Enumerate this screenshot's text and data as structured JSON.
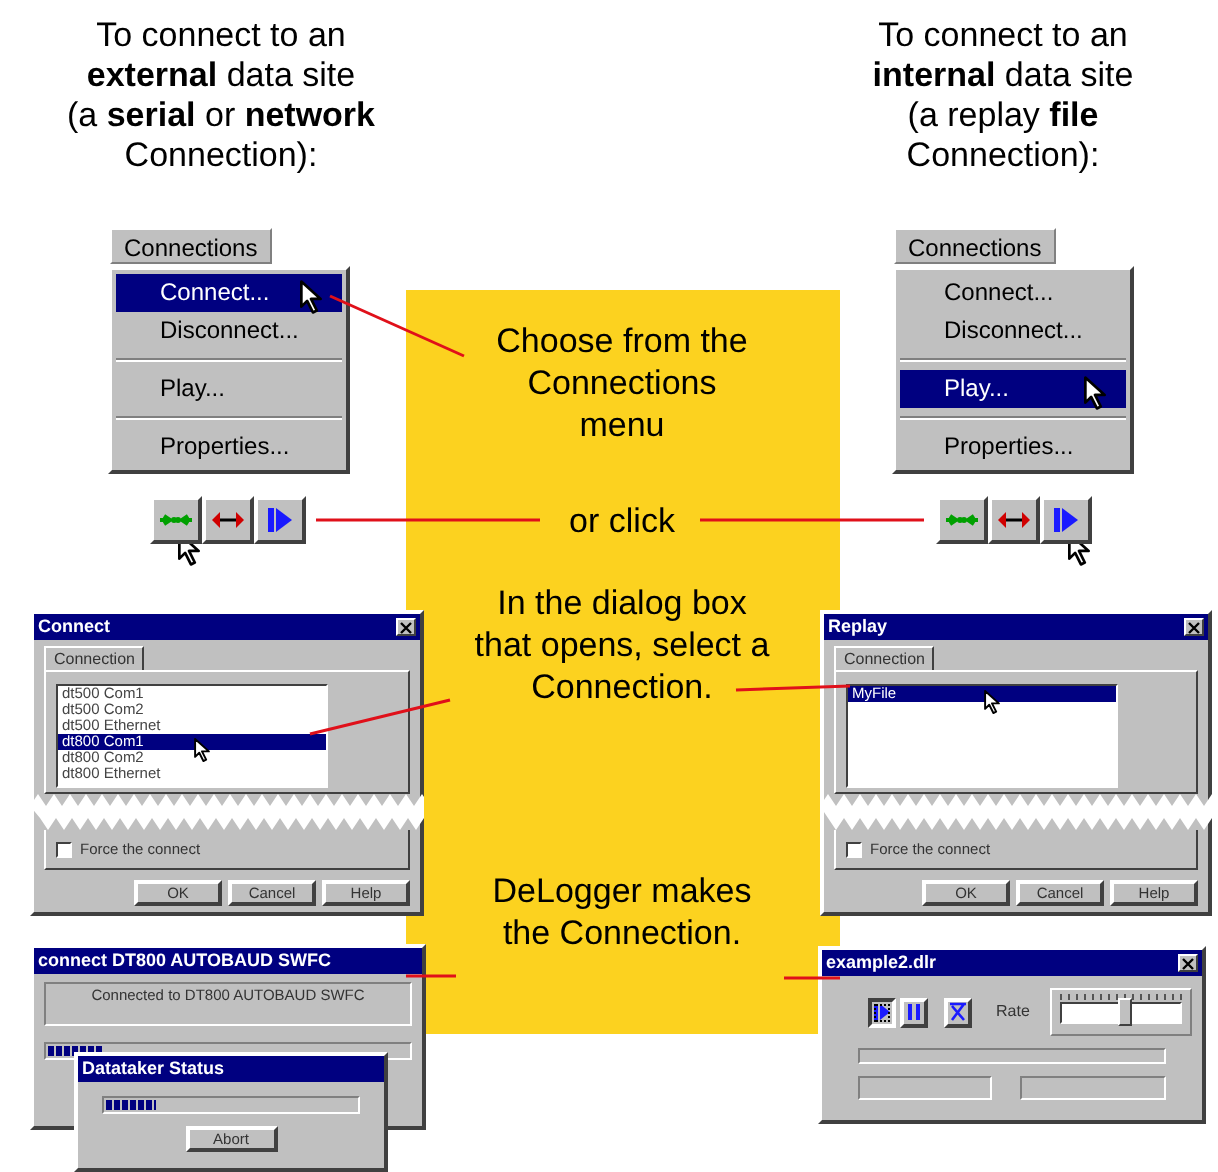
{
  "left_heading": {
    "lines": [
      "To connect to an",
      "**external** data site",
      "(a **serial** or **network**",
      "Connection):"
    ]
  },
  "right_heading": {
    "lines": [
      "To connect to an",
      "**internal** data site",
      "(a replay **file**",
      "Connection):"
    ]
  },
  "steps": [
    {
      "lines": [
        "Choose from the",
        "Connections",
        "menu"
      ]
    },
    {
      "lines": [
        "or click"
      ]
    },
    {
      "lines": [
        "In the dialog box",
        "that opens, select a",
        "Connection."
      ]
    },
    {
      "lines": [
        "DeLogger makes",
        "the Connection."
      ]
    }
  ],
  "menus": [
    {
      "title": "Connections",
      "items": [
        {
          "kind": "item",
          "label": "Connect...",
          "selected": true
        },
        {
          "kind": "item",
          "label": "Disconnect...",
          "selected": false
        },
        {
          "kind": "separator"
        },
        {
          "kind": "item",
          "label": "Play...",
          "selected": false
        },
        {
          "kind": "separator"
        },
        {
          "kind": "item",
          "label": "Properties...",
          "selected": false
        }
      ]
    },
    {
      "title": "Connections",
      "items": [
        {
          "kind": "item",
          "label": "Connect...",
          "selected": false
        },
        {
          "kind": "item",
          "label": "Disconnect...",
          "selected": false
        },
        {
          "kind": "separator"
        },
        {
          "kind": "item",
          "label": "Play...",
          "selected": true
        },
        {
          "kind": "separator"
        },
        {
          "kind": "item",
          "label": "Properties...",
          "selected": false
        }
      ]
    }
  ],
  "toolbars": [
    {
      "buttons": [
        {
          "kind": "connect",
          "hovered": true
        },
        {
          "kind": "disconnect",
          "hovered": false
        },
        {
          "kind": "play",
          "hovered": false
        }
      ]
    },
    {
      "buttons": [
        {
          "kind": "connect",
          "hovered": false
        },
        {
          "kind": "disconnect",
          "hovered": false
        },
        {
          "kind": "play",
          "hovered": true
        }
      ]
    }
  ],
  "dialogs": [
    {
      "title": "Connect",
      "tab": "Connection",
      "items": [
        {
          "label": "dt500 Com1",
          "selected": false
        },
        {
          "label": "dt500 Com2",
          "selected": false
        },
        {
          "label": "dt500 Ethernet",
          "selected": false
        },
        {
          "label": "dt800 Com1",
          "selected": true
        },
        {
          "label": "dt800 Com2",
          "selected": false
        },
        {
          "label": "dt800 Ethernet",
          "selected": false
        }
      ],
      "checkbox": {
        "label": "Force the connect",
        "checked": false
      },
      "buttons": [
        "OK",
        "Cancel",
        "Help"
      ]
    },
    {
      "title": "Replay",
      "tab": "Connection",
      "items": [
        {
          "label": "MyFile",
          "selected": true
        }
      ],
      "checkbox": {
        "label": "Force the connect",
        "checked": false
      },
      "buttons": [
        "OK",
        "Cancel",
        "Help"
      ]
    }
  ],
  "status_window": {
    "title": "connect DT800 AUTOBAUD SWFC",
    "message": "Connected to DT800 AUTOBAUD SWFC",
    "level": 0.15
  },
  "status_dialog": {
    "title": "Datataker Status",
    "level": 0.2,
    "button": "Abort"
  },
  "player": {
    "title": "example2.dlr",
    "buttons": [
      {
        "kind": "play",
        "pressed": true
      },
      {
        "kind": "pause",
        "pressed": false
      },
      {
        "kind": "stop",
        "pressed": false
      }
    ],
    "rate_label": "Rate",
    "rate": {
      "level": 0.55
    }
  }
}
